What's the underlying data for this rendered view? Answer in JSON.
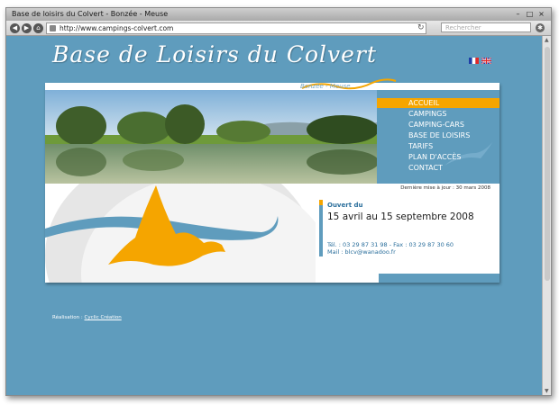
{
  "window": {
    "title": "Base de loisirs du Colvert - Bonzée - Meuse",
    "controls": [
      "–",
      "□",
      "×"
    ]
  },
  "toolbar": {
    "back_icon": "back-arrow-icon",
    "forward_icon": "forward-arrow-icon",
    "home_icon": "home-icon",
    "url": "http://www.campings-colvert.com",
    "search_placeholder": "Rechercher",
    "reload_icon": "reload-icon",
    "settings_icon": "gear-icon"
  },
  "site": {
    "title": "Base de Loisirs du Colvert",
    "subtitle": "Bonzée - Meuse",
    "languages": [
      "fr-flag-icon",
      "en-flag-icon"
    ],
    "menu": [
      {
        "label": "ACCUEIL",
        "active": true
      },
      {
        "label": "CAMPINGS",
        "active": false
      },
      {
        "label": "CAMPING-CARS",
        "active": false
      },
      {
        "label": "BASE DE LOISIRS",
        "active": false
      },
      {
        "label": "TARIFS",
        "active": false
      },
      {
        "label": "PLAN D'ACCÈS",
        "active": false
      },
      {
        "label": "CONTACT",
        "active": false
      }
    ],
    "last_update": "Dernière mise à jour : 30 mars 2008",
    "open_label": "Ouvert du",
    "open_dates": "15 avril au 15 septembre 2008",
    "phone": "Tél. : 03 29 87 31 98 - Fax : 03 29 87 30 60",
    "mail": "Mail : blcv@wanadoo.fr",
    "credit_prefix": "Réalisation :",
    "credit_link": "Cyclic Création"
  },
  "colors": {
    "background": "#5f9cbd",
    "accent": "#f5a500",
    "duck": "#f5a500",
    "text_blue": "#2b6f9c"
  }
}
